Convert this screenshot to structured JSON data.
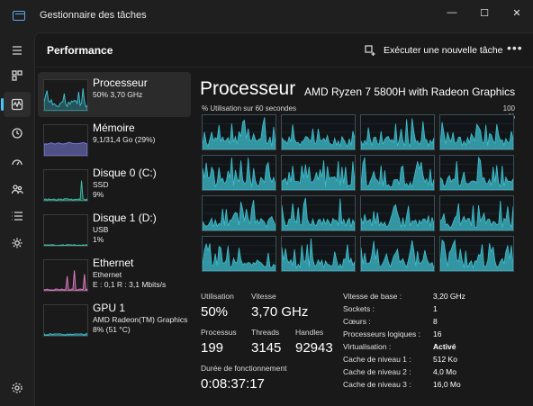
{
  "window": {
    "title": "Gestionnaire des tâches",
    "minimize": "—",
    "maximize": "☐",
    "close": "✕"
  },
  "rail": [
    "menu-icon",
    "processes-icon",
    "performance-icon",
    "history-icon",
    "startup-icon",
    "users-icon",
    "details-icon",
    "services-icon",
    "settings-icon"
  ],
  "header": {
    "title": "Performance",
    "run_task": "Exécuter une nouvelle tâche",
    "more": "•••"
  },
  "resources": [
    {
      "name": "Processeur",
      "sub1": "50%  3,70 GHz",
      "sub2": "",
      "color": "#3fc0d0"
    },
    {
      "name": "Mémoire",
      "sub1": "9,1/31,4 Go (29%)",
      "sub2": "",
      "color": "#7b7fe0"
    },
    {
      "name": "Disque 0 (C:)",
      "sub1": "SSD",
      "sub2": "9%",
      "color": "#3fc0a8"
    },
    {
      "name": "Disque 1 (D:)",
      "sub1": "USB",
      "sub2": "1%",
      "color": "#3fc0a8"
    },
    {
      "name": "Ethernet",
      "sub1": "Ethernet",
      "sub2": "E : 0,1  R : 3,1 Mbits/s",
      "color": "#e07bc0"
    },
    {
      "name": "GPU 1",
      "sub1": "AMD Radeon(TM) Graphics",
      "sub2": "8%  (51 °C)",
      "color": "#3fc0d0"
    }
  ],
  "cpu": {
    "title": "Processeur",
    "model": "AMD Ryzen 7 5800H with Radeon Graphics",
    "axis_label": "% Utilisation sur 60 secondes",
    "axis_max": "100 %",
    "graph_color": "#3fc0d0"
  },
  "stats": {
    "util_label": "Utilisation",
    "util_value": "50%",
    "speed_label": "Vitesse",
    "speed_value": "3,70 GHz",
    "proc_label": "Processus",
    "proc_value": "199",
    "threads_label": "Threads",
    "threads_value": "3145",
    "handles_label": "Handles",
    "handles_value": "92943",
    "uptime_label": "Durée de fonctionnement",
    "uptime_value": "0:08:37:17"
  },
  "specs": [
    {
      "key": "Vitesse de base :",
      "value": "3,20 GHz"
    },
    {
      "key": "Sockets :",
      "value": "1"
    },
    {
      "key": "Cœurs :",
      "value": "8"
    },
    {
      "key": "Processeurs logiques :",
      "value": "16"
    },
    {
      "key": "Virtualisation :",
      "value": "Activé"
    },
    {
      "key": "Cache de niveau 1 :",
      "value": "512 Ko"
    },
    {
      "key": "Cache de niveau 2 :",
      "value": "4,0 Mo"
    },
    {
      "key": "Cache de niveau 3 :",
      "value": "16,0 Mo"
    }
  ]
}
